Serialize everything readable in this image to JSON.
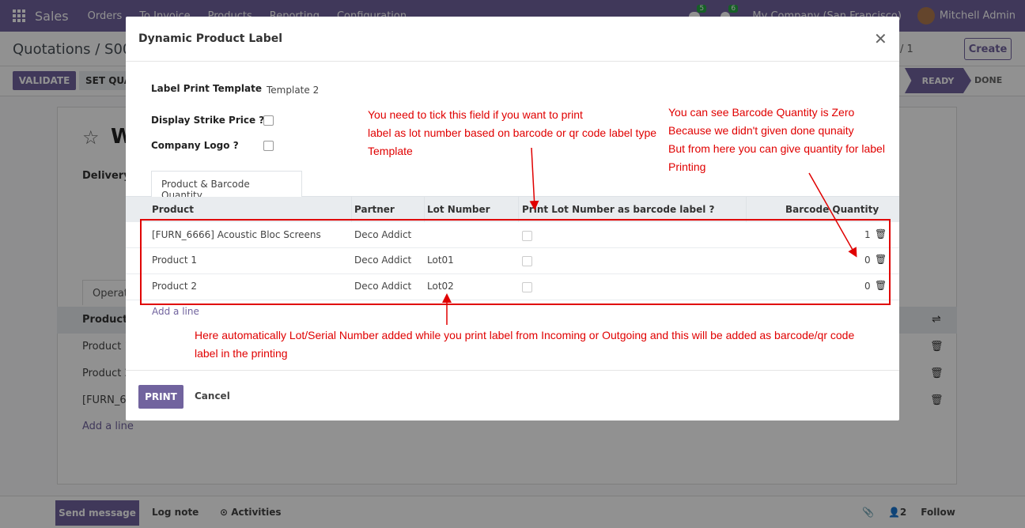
{
  "navbar": {
    "brand": "Sales",
    "menu": [
      "Orders",
      "To Invoice",
      "Products",
      "Reporting",
      "Configuration"
    ],
    "chat_badge": "5",
    "activity_badge": "6",
    "company": "My Company (San Francisco)",
    "user": "Mitchell Admin"
  },
  "background": {
    "breadcrumb": "Quotations / S000",
    "pager": "/ 1",
    "create_label": "Create",
    "validate_label": "VALIDATE",
    "set_qty_label": "SET QUA",
    "stage_ready": "READY",
    "stage_done": "DONE",
    "title": "W",
    "delivery_label": "Delivery A",
    "tab_label": "Operat",
    "table_header": "Product",
    "rows": [
      "Product 1",
      "Product 2",
      "[FURN_666"
    ],
    "add_line": "Add a line",
    "chatter": {
      "send": "Send message",
      "log": "Log note",
      "activities": "Activities",
      "followers": "2",
      "follow": "Follow"
    }
  },
  "modal": {
    "title": "Dynamic Product Label",
    "fields": {
      "template_label": "Label Print Template",
      "template_value": "Template 2",
      "strike_label": "Display Strike Price ?",
      "logo_label": "Company Logo ?"
    },
    "tab": "Product & Barcode Quantity",
    "columns": {
      "product": "Product",
      "partner": "Partner",
      "lot": "Lot Number",
      "print_lot": "Print Lot Number as barcode label ?",
      "qty": "Barcode Quantity"
    },
    "rows": [
      {
        "product": "[FURN_6666] Acoustic Bloc Screens",
        "partner": "Deco Addict",
        "lot": "",
        "qty": "1"
      },
      {
        "product": "Product 1",
        "partner": "Deco Addict",
        "lot": "Lot01",
        "qty": "0"
      },
      {
        "product": "Product 2",
        "partner": "Deco Addict",
        "lot": "Lot02",
        "qty": "0"
      }
    ],
    "add_line": "Add a line",
    "print_label": "PRINT",
    "cancel_label": "Cancel"
  },
  "annotations": {
    "tick_note": [
      "You need to tick this field if you want to print",
      "label as lot number based on barcode or qr code label type",
      "Template"
    ],
    "qty_note": [
      "You can see Barcode Quantity is Zero",
      "Because we didn't given done qunaity",
      "But from here you can give quantity for label",
      "Printing"
    ],
    "lot_note": [
      "Here automatically Lot/Serial Number added while you print label from Incoming or Outgoing and this will be added as barcode/qr code",
      "label in the printing"
    ]
  },
  "colors": {
    "brand": "#71639e",
    "annotation": "#e00000"
  }
}
